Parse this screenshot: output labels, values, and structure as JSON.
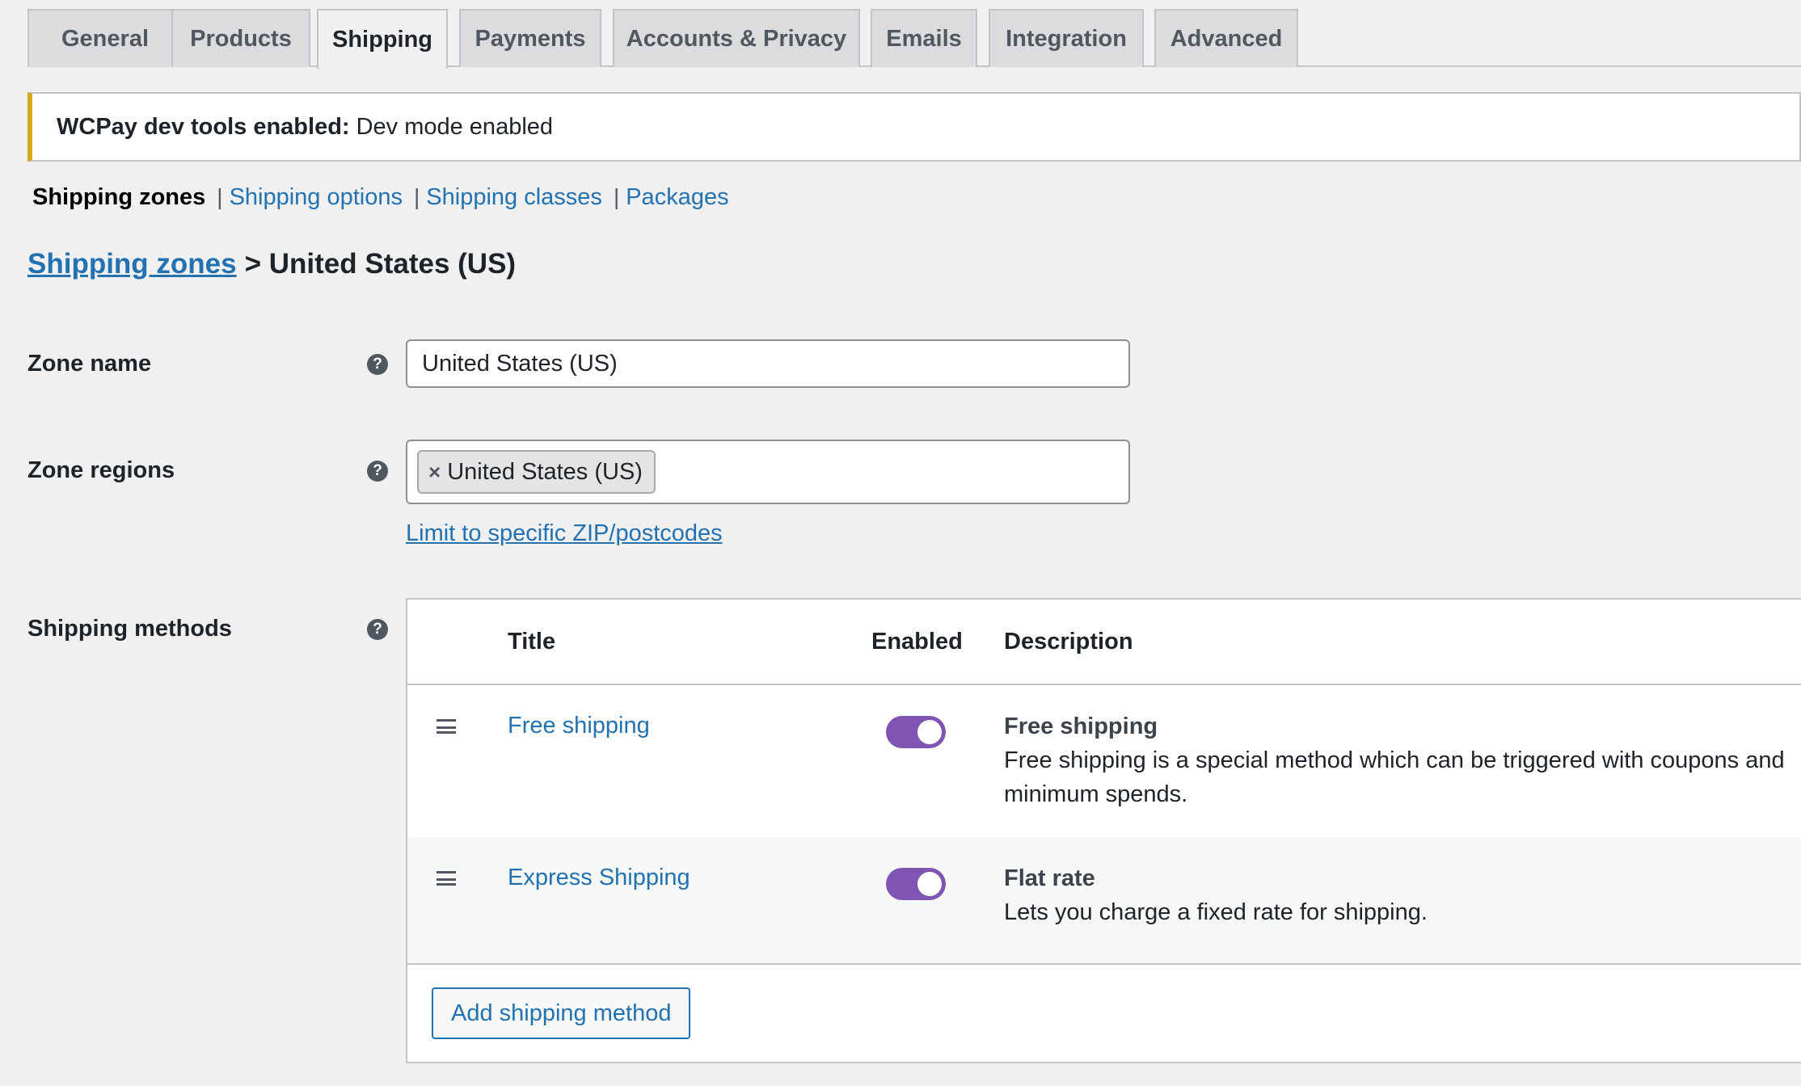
{
  "tabs": [
    {
      "label": "General"
    },
    {
      "label": "Products"
    },
    {
      "label": "Shipping",
      "active": true
    },
    {
      "label": "Payments"
    },
    {
      "label": "Accounts & Privacy"
    },
    {
      "label": "Emails"
    },
    {
      "label": "Integration"
    },
    {
      "label": "Advanced"
    }
  ],
  "notice": {
    "title": "WCPay dev tools enabled:",
    "message": "Dev mode enabled",
    "accent_color": "#dba617"
  },
  "subnav": {
    "current": "Shipping zones",
    "links": [
      "Shipping options",
      "Shipping classes",
      "Packages"
    ],
    "separator": "|"
  },
  "breadcrumb": {
    "link": "Shipping zones",
    "rest": "> United States (US)"
  },
  "form": {
    "zone_name": {
      "label": "Zone name",
      "value": "United States (US)"
    },
    "zone_regions": {
      "label": "Zone regions",
      "chips": [
        "United States (US)"
      ],
      "limit_link": "Limit to specific ZIP/postcodes"
    },
    "shipping_methods": {
      "label": "Shipping methods"
    },
    "help_icon": "?"
  },
  "methods": {
    "headers": {
      "title": "Title",
      "enabled": "Enabled",
      "description": "Description"
    },
    "rows": [
      {
        "title": "Free shipping",
        "enabled": true,
        "desc_title": "Free shipping",
        "desc_text": "Free shipping is a special method which can be triggered with coupons and minimum spends."
      },
      {
        "title": "Express Shipping",
        "enabled": true,
        "desc_title": "Flat rate",
        "desc_text": "Lets you charge a fixed rate for shipping."
      }
    ],
    "add_button": "Add shipping method",
    "toggle_color": "#7f54b3"
  },
  "icons": {
    "chip_remove": "×",
    "help": "help-circle-icon",
    "drag": "drag-handle-icon"
  }
}
